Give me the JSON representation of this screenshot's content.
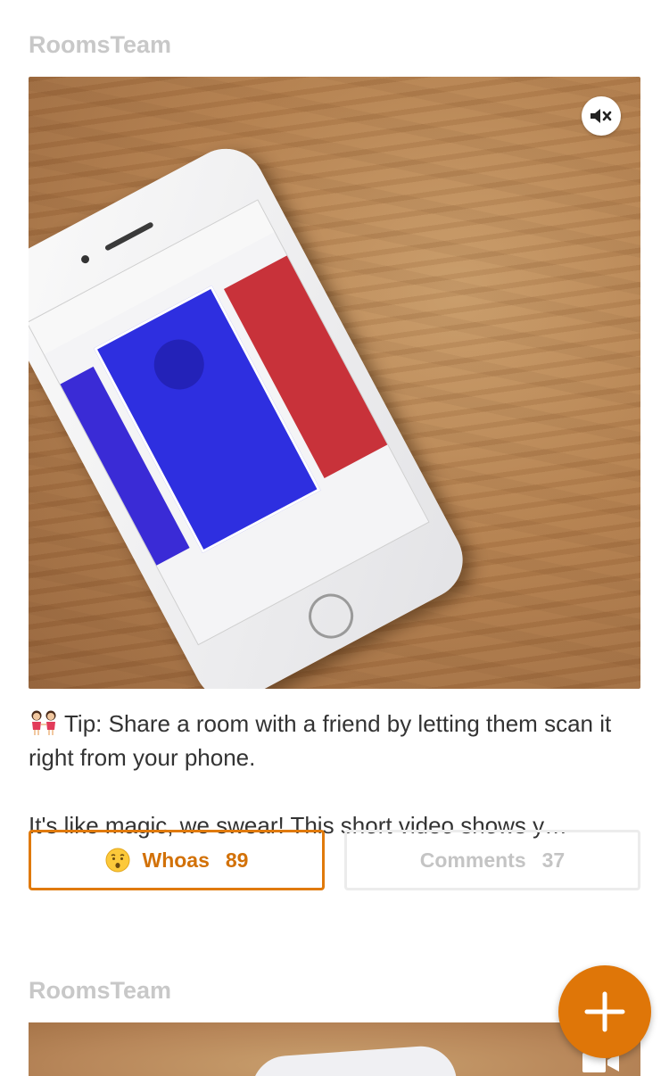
{
  "feed": {
    "posts": [
      {
        "author": "RoomsTeam",
        "media": {
          "type": "video",
          "muted": true,
          "icon": "mute-icon"
        },
        "caption": {
          "emoji_icon": "two-girls-holding-hands-icon",
          "line1": "Tip: Share a room with a friend by letting them scan it right from your phone.",
          "line2": "It's like magic, we swear! This short video shows y…"
        },
        "actions": {
          "whoas": {
            "emoji_icon": "hushed-face-icon",
            "label": "Whoas",
            "count": "89"
          },
          "comments": {
            "label": "Comments",
            "count": "37"
          }
        }
      },
      {
        "author": "RoomsTeam",
        "media": {
          "type": "video",
          "icon": "video-camera-icon"
        }
      }
    ]
  },
  "fab": {
    "icon": "plus-icon"
  },
  "colors": {
    "accent": "#df7608",
    "author": "#c8c8c8",
    "text": "#333333",
    "comments_border": "#ececec"
  }
}
